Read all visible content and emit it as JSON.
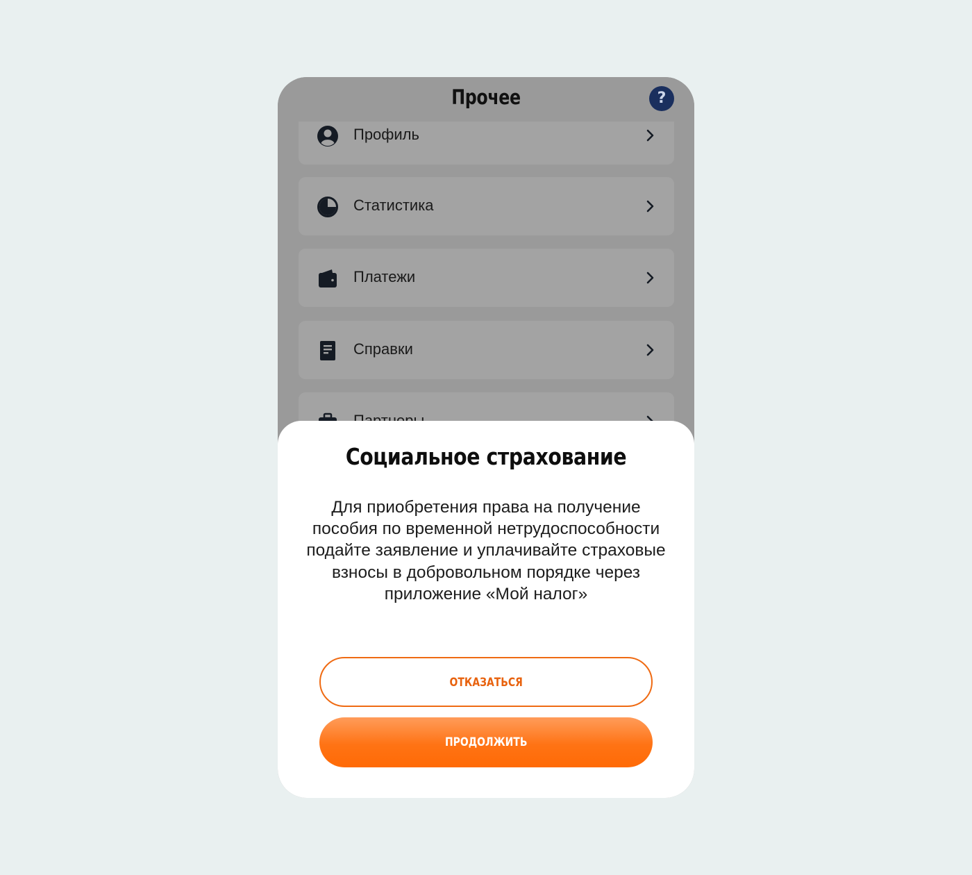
{
  "header": {
    "title": "Прочее",
    "help_label": "?"
  },
  "menu": {
    "items": [
      {
        "label": "Профиль",
        "icon": "user-circle-icon"
      },
      {
        "label": "Статистика",
        "icon": "pie-chart-icon"
      },
      {
        "label": "Платежи",
        "icon": "wallet-icon"
      },
      {
        "label": "Справки",
        "icon": "document-icon"
      },
      {
        "label": "Партнеры",
        "icon": "briefcase-icon"
      }
    ]
  },
  "dialog": {
    "title": "Социальное страхование",
    "message": "Для приобретения права на получение пособия по временной нетрудоспособности подайте заявление и уплачивайте страховые взносы в добровольном порядке через приложение «Мой налог»",
    "decline_label": "ОТКАЗАТЬСЯ",
    "continue_label": "ПРОДОЛЖИТЬ"
  },
  "colors": {
    "accent": "#ff7314",
    "overlay": "#9a9a9a",
    "help_button": "#1a2f5e",
    "background": "#e9f0f0"
  }
}
